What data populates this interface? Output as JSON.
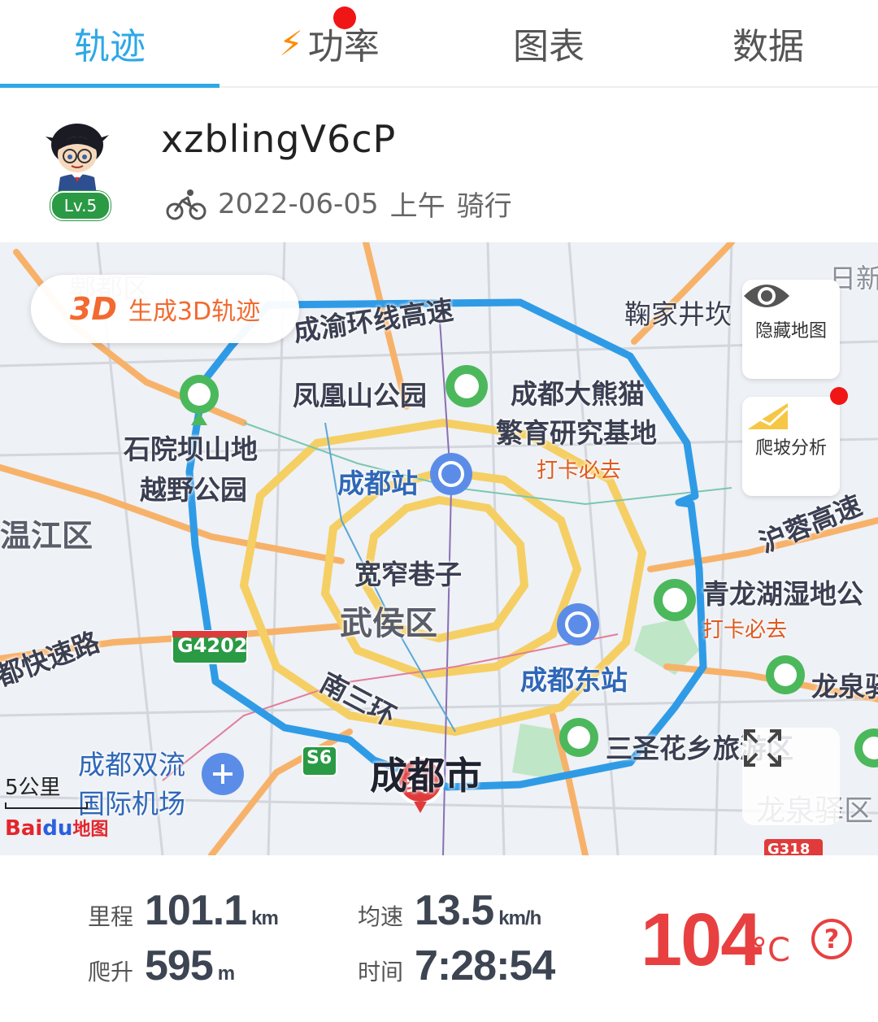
{
  "tabs": [
    {
      "label": "轨迹",
      "active": true
    },
    {
      "label": "功率",
      "badge": true
    },
    {
      "label": "图表"
    },
    {
      "label": "数据"
    }
  ],
  "profile": {
    "username": "xzblingV6cP",
    "level": "Lv.5",
    "date": "2022-06-05",
    "period": "上午",
    "activity": "骑行"
  },
  "map": {
    "button_3d_icon": "3D",
    "button_3d_label": "生成3D轨迹",
    "hide_map_label": "隐藏地图",
    "climb_analysis_label": "爬坡分析",
    "scale_label": "5公里",
    "provider": {
      "bai": "Bai",
      "du": "du",
      "map": "地图"
    },
    "end_marker": "终",
    "labels": {
      "pidu": "郫都区",
      "xinfan": "日新",
      "ring_highway": "成渝环线高速",
      "jujia": "鞠家井坎",
      "fenghuang": "凤凰山公园",
      "panda1": "成都大熊猫",
      "panda2": "繁育研究基地",
      "checkin1": "打卡必去",
      "shiyuan1": "石院坝山地",
      "shiyuan2": "越野公园",
      "chengdu_station": "成都站",
      "wenjiang": "温江区",
      "hurong": "沪蓉高速",
      "kuanzhai": "宽窄巷子",
      "qinglonghu": "青龙湖湿地公",
      "checkin2": "打卡必去",
      "wuhou": "武侯区",
      "expressway": "都快速路",
      "g4202": "G4202",
      "east_station": "成都东站",
      "longquan": "龙泉驿",
      "nansanhuan": "南三环",
      "sansheng": "三圣花乡旅游区",
      "shuangliu1": "成都双流",
      "shuangliu2": "国际机场",
      "s6": "S6",
      "chengdu_city": "成都市",
      "longquan_bottom": "龙泉驿区",
      "g318": "G318"
    }
  },
  "stats": {
    "distance_label": "里程",
    "distance_value": "101.1",
    "distance_unit": "km",
    "avg_speed_label": "均速",
    "avg_speed_value": "13.5",
    "avg_speed_unit": "km/h",
    "climb_label": "爬升",
    "climb_value": "595",
    "climb_unit": "m",
    "time_label": "时间",
    "time_value": "7:28:54",
    "temperature_value": "104",
    "temperature_unit": "°C",
    "help_icon": "?"
  },
  "colors": {
    "accent": "#2ea8e6",
    "track": "#2f9be6",
    "temperature": "#e84040",
    "orange": "#f26a30"
  }
}
